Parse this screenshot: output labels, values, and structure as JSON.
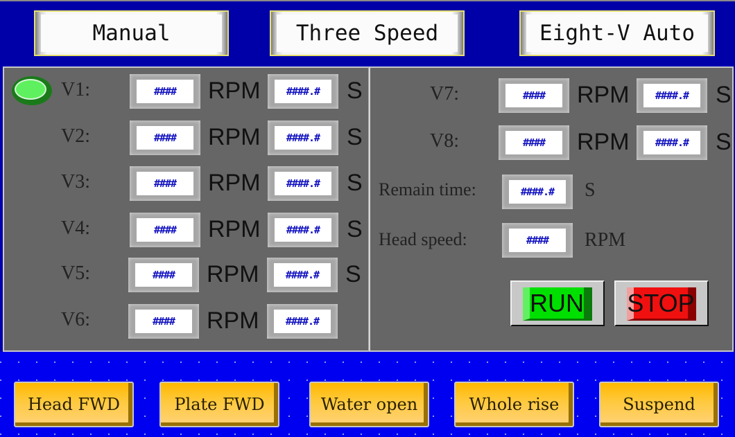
{
  "mode_tabs": [
    {
      "label": "Manual"
    },
    {
      "label": "Three Speed"
    },
    {
      "label": "Eight-V Auto"
    }
  ],
  "status_indicator": {
    "state": "on",
    "color": "#5ef05e"
  },
  "steps": [
    {
      "label": "V1:",
      "speed": "####",
      "speed_unit": "RPM",
      "time": "####.#",
      "time_unit": "S"
    },
    {
      "label": "V2:",
      "speed": "####",
      "speed_unit": "RPM",
      "time": "####.#",
      "time_unit": "S"
    },
    {
      "label": "V3:",
      "speed": "####",
      "speed_unit": "RPM",
      "time": "####.#",
      "time_unit": "S"
    },
    {
      "label": "V4:",
      "speed": "####",
      "speed_unit": "RPM",
      "time": "####.#",
      "time_unit": "S"
    },
    {
      "label": "V5:",
      "speed": "####",
      "speed_unit": "RPM",
      "time": "####.#",
      "time_unit": "S"
    },
    {
      "label": "V6:",
      "speed": "####",
      "speed_unit": "RPM",
      "time": "####.#",
      "time_unit": ""
    },
    {
      "label": "V7:",
      "speed": "####",
      "speed_unit": "RPM",
      "time": "####.#",
      "time_unit": "S"
    },
    {
      "label": "V8:",
      "speed": "####",
      "speed_unit": "RPM",
      "time": "####.#",
      "time_unit": "S"
    }
  ],
  "status": {
    "remain_time": {
      "label": "Remain time:",
      "value": "####.#",
      "unit": "S"
    },
    "head_speed": {
      "label": "Head speed:",
      "value": "####",
      "unit": "RPM"
    }
  },
  "controls": {
    "run_label": "RUN",
    "stop_label": "STOP",
    "run_color": "#00e000",
    "stop_color": "#f01010"
  },
  "function_buttons": [
    {
      "label": "Head FWD"
    },
    {
      "label": "Plate FWD"
    },
    {
      "label": "Water open"
    },
    {
      "label": "Whole rise"
    },
    {
      "label": "Suspend"
    }
  ],
  "colors": {
    "background": "#0000b0",
    "panel": "#666666",
    "button_amber": "#ffb800",
    "value_text": "#1010c0"
  }
}
